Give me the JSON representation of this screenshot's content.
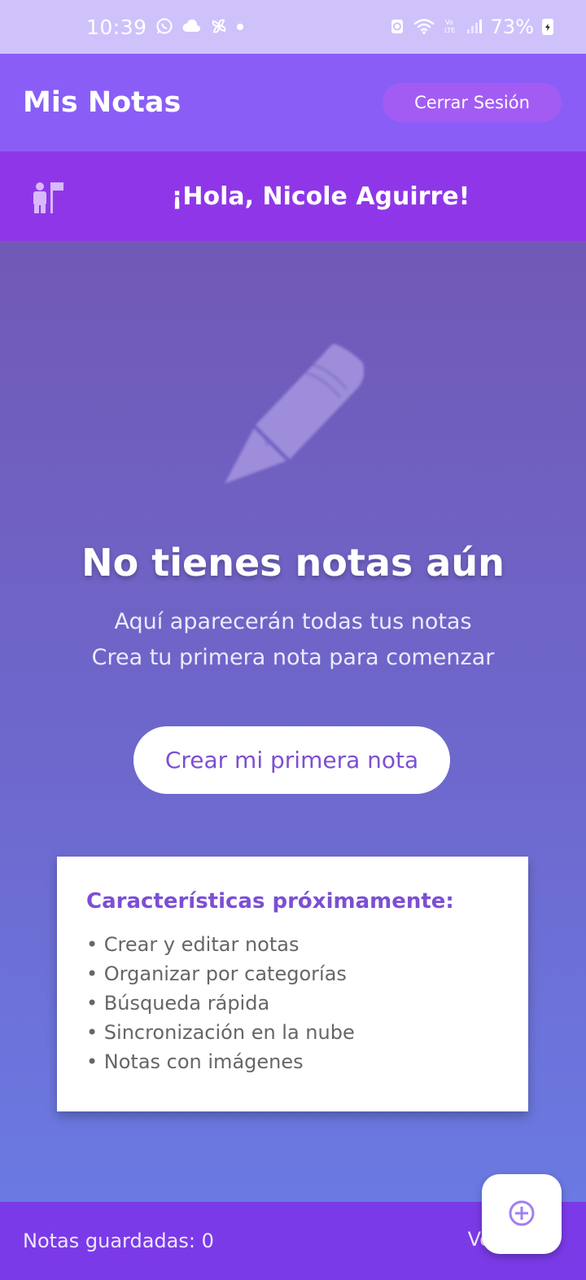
{
  "status_bar": {
    "time": "10:39",
    "battery": "73%",
    "icons": [
      "whatsapp-icon",
      "cloud-icon",
      "pinwheel-icon",
      "dot-icon",
      "data-saver-icon",
      "wifi-icon",
      "volte-icon",
      "signal-icon",
      "battery-icon"
    ]
  },
  "appbar": {
    "title": "Mis Notas",
    "logout_label": "Cerrar Sesión"
  },
  "greeting": {
    "text": "¡Hola, Nicole Aguirre!",
    "icon": "person-flag-icon"
  },
  "empty_state": {
    "icon": "pencil-icon",
    "title": "No tienes notas aún",
    "subtitle_line1": "Aquí aparecerán todas tus notas",
    "subtitle_line2": "Crea tu primera nota para comenzar",
    "button_label": "Crear mi primera nota"
  },
  "features": {
    "title": "Características próximamente:",
    "items": [
      "• Crear y editar notas",
      "• Organizar por categorías",
      "• Búsqueda rápida",
      "• Sincronización en la nube",
      "• Notas con imágenes"
    ]
  },
  "footer": {
    "count_label": "Notas guardadas: 0",
    "right_text": "Ve"
  },
  "fab": {
    "icon": "add-circle-icon"
  },
  "colors": {
    "appbar": "#8a5ef6",
    "greeting": "#8f37e8",
    "footer": "#7b3ae8",
    "accent_text": "#7c4fd4"
  }
}
